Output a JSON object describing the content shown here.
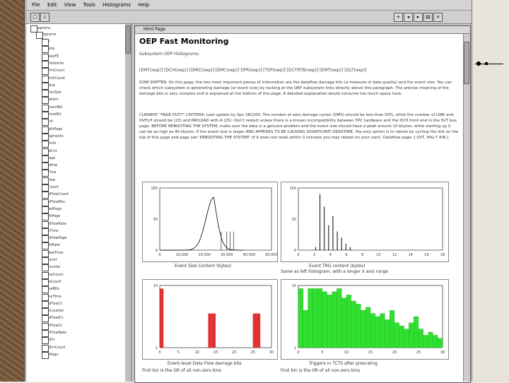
{
  "menu": {
    "items": [
      "File",
      "Edit",
      "View",
      "Tools",
      "Histograms",
      "Help"
    ]
  },
  "tree": {
    "root": "Histograms",
    "child": "Histograms",
    "items": [
      "Sbar",
      "EvtSize",
      "EvtSizeFE",
      "TrigHistoInfo",
      "BadTmCount",
      "PatUnitCount",
      "OvrSize",
      "ClusterSize",
      "CsPattern",
      "EvtEventBd",
      "ChannelBd",
      "ErrCnt",
      "LengthPage",
      "FeSegments",
      "TrSgInfo",
      "WordCnt",
      "GtlPage",
      "Dataflow",
      "HdrFlow",
      "FllrFlow",
      "HdrCount",
      "DataFlowCount",
      "DataFlowBits",
      "EvtRelPage",
      "TrgBitPage",
      "DataFlowRate",
      "FlowTime",
      "DataFlowPage",
      "TrgBitRate",
      "BitFlowTime",
      "BitCount",
      "BitCounter",
      "FrameCount",
      "HistoCount",
      "FrameBits",
      "FrameTime",
      "DataFlowCt",
      "FlowCounter",
      "DataFlowErr",
      "OverFlowCt",
      "OverFlowRate",
      "FlowErr",
      "FlowErrCount",
      "FlowPage"
    ]
  },
  "html_window": {
    "title": "Html Page",
    "heading": "OEP Fast Monitoring",
    "subtitle": "Subsystem OEP Histograms:",
    "links": "[EMT(oep)] [DCH(oep)] [DIRC(oep)] [EMC(oep)] [IFR(oep)] [TSP(oep)] [DCTRTB(oep)] [EMT(oep)] [GLT(oep)]",
    "para1": "DOM SHIFTER: On this page, the two most important pieces of information are the dataflow damage bits (a measure of data quality) and the event size. You can check which subsystem is generating damage (or event size) by looking at the OEP subsystem links directly above this paragraph. The precise meaning of the damage bits is very complex and is explained at the bottom of this page. A detailed explanation would consume too much space here.",
    "para2": "CURRENT \"PAGE DUTY\" CRITERIA: Last update by Spo 28/2/00. The number of zero damage cycles (DMS) should be less than 50%, while the number of LINK and OVFLH should be (23) and PAYLOAD with A (25). Don't restart unless there is a known incompatibility between TPC hardware and the DCH front end in the SVT bus page. BEFORE REBOOTING THE SYSTEM, make sure the data is a genuine problem and the event size should have a peak around 10 kbytes, while starting up it can be as high as 40 kbytes. If the event size is larger AND APPEARS TO BE CAUSING SIGNIFICANT DEADTIME, the only option is to reboot by cycling the link on the top of this page and page see 'REBOOTING THE SYSTEM' (if it does not reset within 3 minutes you may reboot on your own). Dataflow page: [ SVT, HAL-T A/B ]",
    "plots": [
      {
        "ylabels": [
          "100",
          "50",
          "0"
        ],
        "xlabels": [
          "0",
          "10,000",
          "20,000",
          "30,000",
          "40,000",
          "50,000"
        ],
        "caption": "Event Size Content (bytes)"
      },
      {
        "ylabels": [
          "100",
          "50",
          "0"
        ],
        "xlabels": [
          "0",
          "2",
          "4",
          "6",
          "8",
          "10",
          "12",
          "14",
          "16",
          "18"
        ],
        "caption": "Event TRG content (bytes)"
      },
      {
        "ylabels": [
          "10",
          "1"
        ],
        "xlabels": [
          "0",
          "5",
          "10",
          "15",
          "20",
          "25",
          "30"
        ],
        "caption": "Event-level Data Flow damage bits"
      },
      {
        "ylabels": [
          "10",
          "1"
        ],
        "xlabels": [
          "0",
          "5",
          "10",
          "15",
          "20",
          "25",
          "30"
        ],
        "caption": "Triggers in TCTS after prescaling"
      }
    ],
    "caption2_extra": "Same as left histogram, with a longer X axis range",
    "footer_left": "First bin is the OR of all non-zero bins",
    "footer_right": "First bin is the OR of all non-zero bins"
  },
  "colors": {
    "red_bars": "#e03030",
    "green_bars": "#30e030"
  }
}
